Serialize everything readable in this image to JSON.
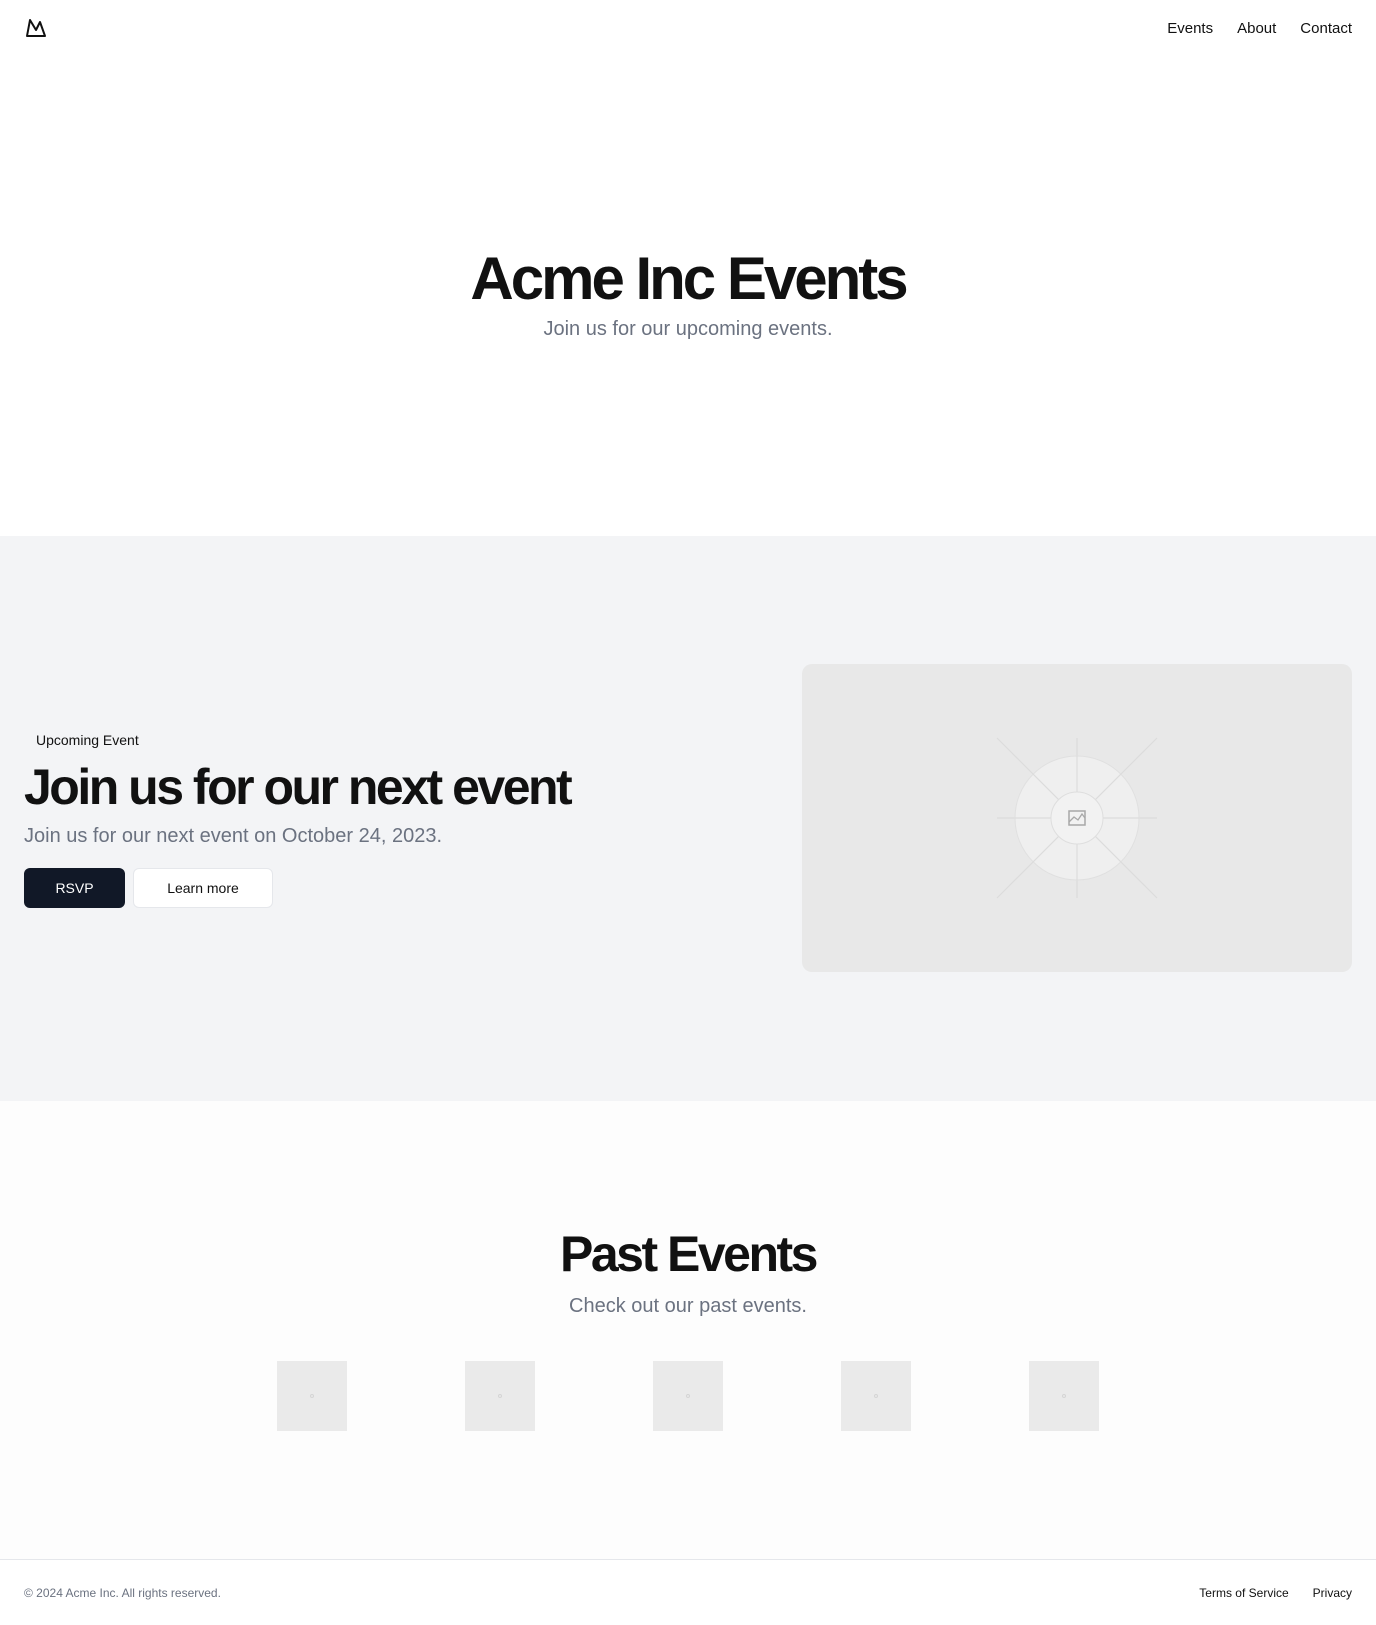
{
  "nav": {
    "items": [
      "Events",
      "About",
      "Contact"
    ]
  },
  "hero": {
    "title": "Acme Inc Events",
    "subtitle": "Join us for our upcoming events."
  },
  "upcoming": {
    "badge": "Upcoming Event",
    "title": "Join us for our next event",
    "subtitle": "Join us for our next event on October 24, 2023.",
    "rsvp": "RSVP",
    "learn_more": "Learn more"
  },
  "past": {
    "title": "Past Events",
    "subtitle": "Check out our past events."
  },
  "footer": {
    "copyright": "© 2024 Acme Inc. All rights reserved.",
    "links": [
      "Terms of Service",
      "Privacy"
    ]
  }
}
